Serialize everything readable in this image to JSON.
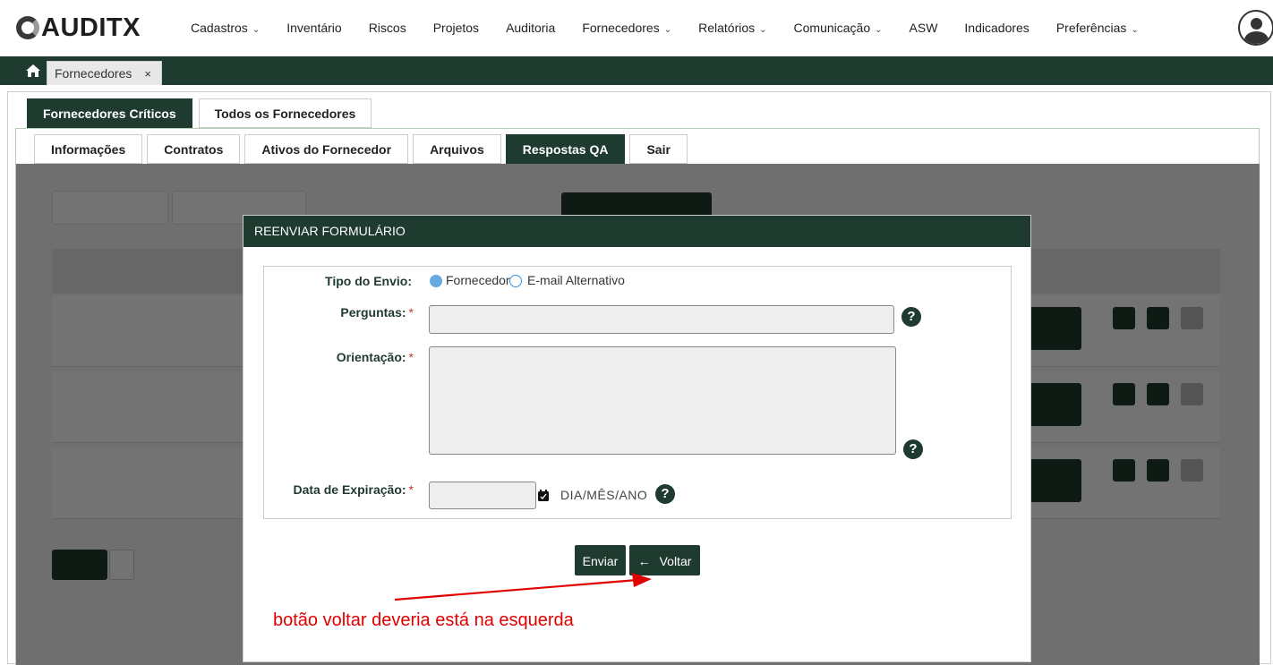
{
  "brand": {
    "name": "AUDITX"
  },
  "nav": {
    "items": [
      {
        "label": "Cadastros",
        "dropdown": true
      },
      {
        "label": "Inventário",
        "dropdown": false
      },
      {
        "label": "Riscos",
        "dropdown": false
      },
      {
        "label": "Projetos",
        "dropdown": false
      },
      {
        "label": "Auditoria",
        "dropdown": false
      },
      {
        "label": "Fornecedores",
        "dropdown": true
      },
      {
        "label": "Relatórios",
        "dropdown": true
      },
      {
        "label": "Comunicação",
        "dropdown": true
      },
      {
        "label": "ASW",
        "dropdown": false
      },
      {
        "label": "Indicadores",
        "dropdown": false
      },
      {
        "label": "Preferências",
        "dropdown": true
      }
    ],
    "user_icon": "user-circle-icon"
  },
  "page_tabs": {
    "home_icon": "home-icon",
    "current": "Fornecedores",
    "close": "×"
  },
  "top_tabs": [
    {
      "label": "Fornecedores Críticos",
      "active": true
    },
    {
      "label": "Todos os Fornecedores",
      "active": false
    }
  ],
  "sub_tabs": [
    {
      "label": "Informações",
      "active": false
    },
    {
      "label": "Contratos",
      "active": false
    },
    {
      "label": "Ativos do Fornecedor",
      "active": false
    },
    {
      "label": "Arquivos",
      "active": false
    },
    {
      "label": "Respostas QA",
      "active": true
    },
    {
      "label": "Sair",
      "active": false
    }
  ],
  "modal": {
    "title": "REENVIAR FORMULÁRIO",
    "tipo_envio": {
      "label": "Tipo do Envio:",
      "options": [
        {
          "label": "Fornecedor",
          "selected": true
        },
        {
          "label": "E-mail Alternativo",
          "selected": false
        }
      ]
    },
    "perguntas": {
      "label": "Perguntas:",
      "value": ""
    },
    "orientacao": {
      "label": "Orientação:",
      "value": ""
    },
    "data_expiracao": {
      "label": "Data de Expiração:",
      "value": "",
      "format": "DIA/MÊS/ANO"
    },
    "required_mark": "*",
    "help": "?",
    "buttons": {
      "send": "Enviar",
      "back": "Voltar"
    }
  },
  "annotation": {
    "text": "botão voltar deveria está na esquerda"
  },
  "colors": {
    "primary": "#1f3a2e",
    "annotation": "#e00000",
    "radio": "#66a9e0"
  }
}
